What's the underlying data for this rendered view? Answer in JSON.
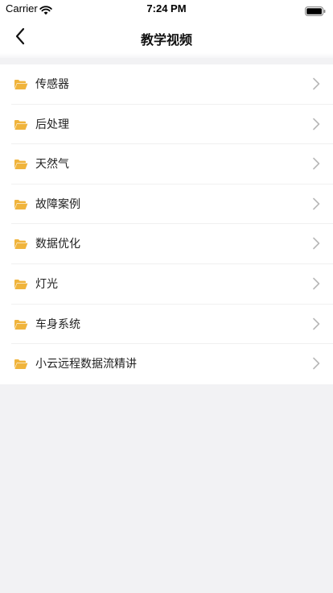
{
  "status_bar": {
    "carrier": "Carrier",
    "time": "7:24 PM"
  },
  "nav": {
    "title": "教学视频",
    "back_icon": "chevron-left-icon"
  },
  "list": {
    "items": [
      {
        "label": "传感器"
      },
      {
        "label": "后处理"
      },
      {
        "label": "天然气"
      },
      {
        "label": "故障案例"
      },
      {
        "label": "数据优化"
      },
      {
        "label": "灯光"
      },
      {
        "label": "车身系统"
      },
      {
        "label": "小云远程数据流精讲"
      }
    ],
    "item_icon": "folder-open-icon",
    "trailing_icon": "chevron-right-icon"
  },
  "colors": {
    "folder": "#f0b43c",
    "chevron": "#b8b8b8",
    "background": "#f2f2f4"
  }
}
